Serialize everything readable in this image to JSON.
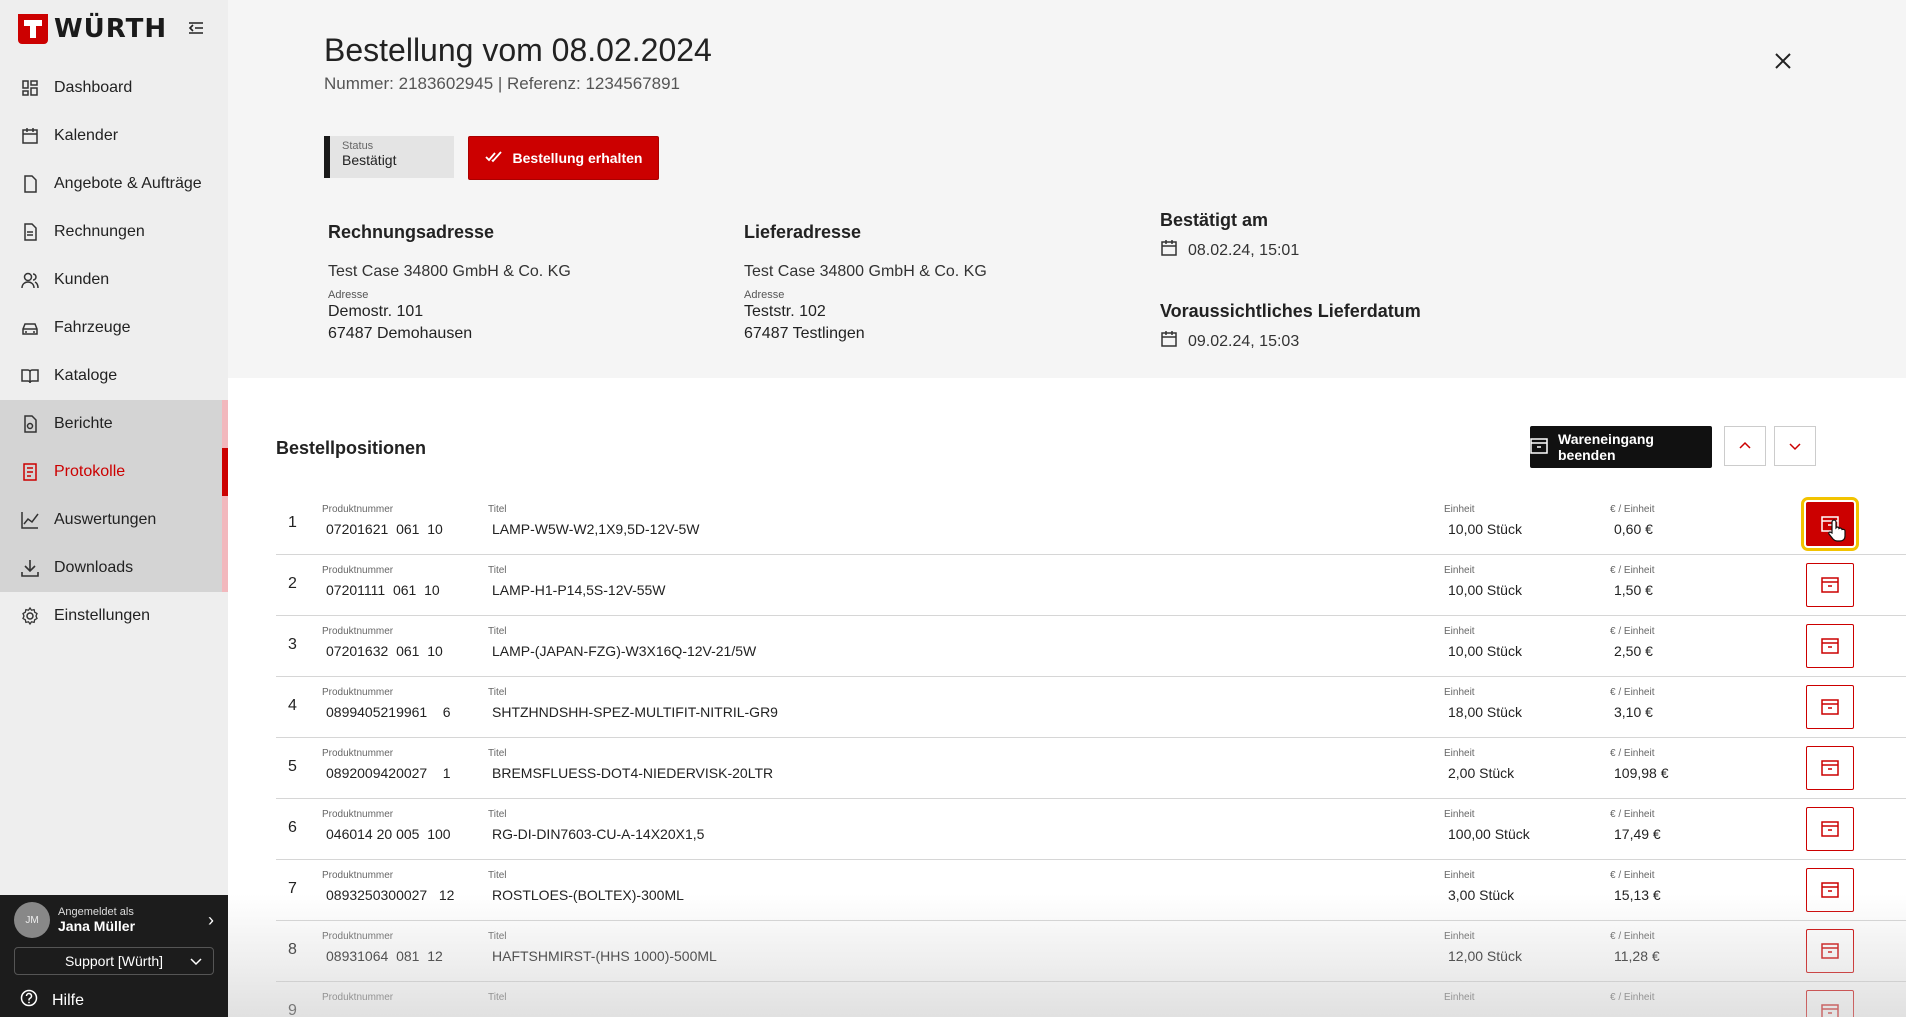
{
  "brand": {
    "logo_text": "WÜRTH",
    "accent": "#cc0000"
  },
  "sidebar": {
    "items": [
      {
        "label": "Dashboard",
        "icon": "dashboard-icon"
      },
      {
        "label": "Kalender",
        "icon": "calendar-icon"
      },
      {
        "label": "Angebote & Aufträge",
        "icon": "document-icon"
      },
      {
        "label": "Rechnungen",
        "icon": "invoice-icon"
      },
      {
        "label": "Kunden",
        "icon": "users-icon"
      },
      {
        "label": "Fahrzeuge",
        "icon": "car-icon"
      },
      {
        "label": "Kataloge",
        "icon": "book-icon"
      },
      {
        "label": "Berichte",
        "icon": "report-icon"
      },
      {
        "label": "Protokolle",
        "icon": "protocol-icon"
      },
      {
        "label": "Auswertungen",
        "icon": "chart-icon"
      },
      {
        "label": "Downloads",
        "icon": "download-icon"
      },
      {
        "label": "Einstellungen",
        "icon": "gear-icon"
      }
    ],
    "user": {
      "logged_in_as": "Angemeldet als",
      "name": "Jana Müller",
      "initials": "JM",
      "role": "Support [Würth]"
    },
    "help": "Hilfe"
  },
  "order": {
    "title": "Bestellung vom 08.02.2024",
    "subtitle": "Nummer: 2183602945 | Referenz: 1234567891",
    "status_label": "Status",
    "status_value": "Bestätigt",
    "receive_button": "Bestellung erhalten",
    "billing": {
      "heading": "Rechnungsadresse",
      "company": "Test Case 34800 GmbH & Co. KG",
      "label": "Adresse",
      "street": "Demostr. 101",
      "city": "67487 Demohausen"
    },
    "shipping": {
      "heading": "Lieferadresse",
      "company": "Test Case 34800 GmbH & Co. KG",
      "label": "Adresse",
      "street": "Teststr. 102",
      "city": "67487 Testlingen"
    },
    "confirmed": {
      "heading": "Bestätigt am",
      "value": "08.02.24, 15:01"
    },
    "delivery": {
      "heading": "Voraussichtliches Lieferdatum",
      "value": "09.02.24, 15:03"
    }
  },
  "positions": {
    "heading": "Bestellpositionen",
    "finish_button": "Wareneingang beenden",
    "col_product": "Produktnummer",
    "col_title": "Titel",
    "col_unit": "Einheit",
    "col_price": "€ / Einheit",
    "rows": [
      {
        "n": "1",
        "product": "07201621  061  10",
        "title": "LAMP-W5W-W2,1X9,5D-12V-5W",
        "unit": "10,00 Stück",
        "price": "0,60 €"
      },
      {
        "n": "2",
        "product": "07201111  061  10",
        "title": "LAMP-H1-P14,5S-12V-55W",
        "unit": "10,00 Stück",
        "price": "1,50 €"
      },
      {
        "n": "3",
        "product": "07201632  061  10",
        "title": "LAMP-(JAPAN-FZG)-W3X16Q-12V-21/5W",
        "unit": "10,00 Stück",
        "price": "2,50 €"
      },
      {
        "n": "4",
        "product": "0899405219961    6",
        "title": "SHTZHNDSHH-SPEZ-MULTIFIT-NITRIL-GR9",
        "unit": "18,00 Stück",
        "price": "3,10 €"
      },
      {
        "n": "5",
        "product": "0892009420027    1",
        "title": "BREMSFLUESS-DOT4-NIEDERVISK-20LTR",
        "unit": "2,00 Stück",
        "price": "109,98 €"
      },
      {
        "n": "6",
        "product": "046014 20 005  100",
        "title": "RG-DI-DIN7603-CU-A-14X20X1,5",
        "unit": "100,00 Stück",
        "price": "17,49 €"
      },
      {
        "n": "7",
        "product": "0893250300027   12",
        "title": "ROSTLOES-(BOLTEX)-300ML",
        "unit": "3,00 Stück",
        "price": "15,13 €"
      },
      {
        "n": "8",
        "product": "08931064  081  12",
        "title": "HAFTSHMIRST-(HHS 1000)-500ML",
        "unit": "12,00 Stück",
        "price": "11,28 €"
      },
      {
        "n": "9",
        "product": "",
        "title": "",
        "unit": "",
        "price": ""
      }
    ]
  }
}
